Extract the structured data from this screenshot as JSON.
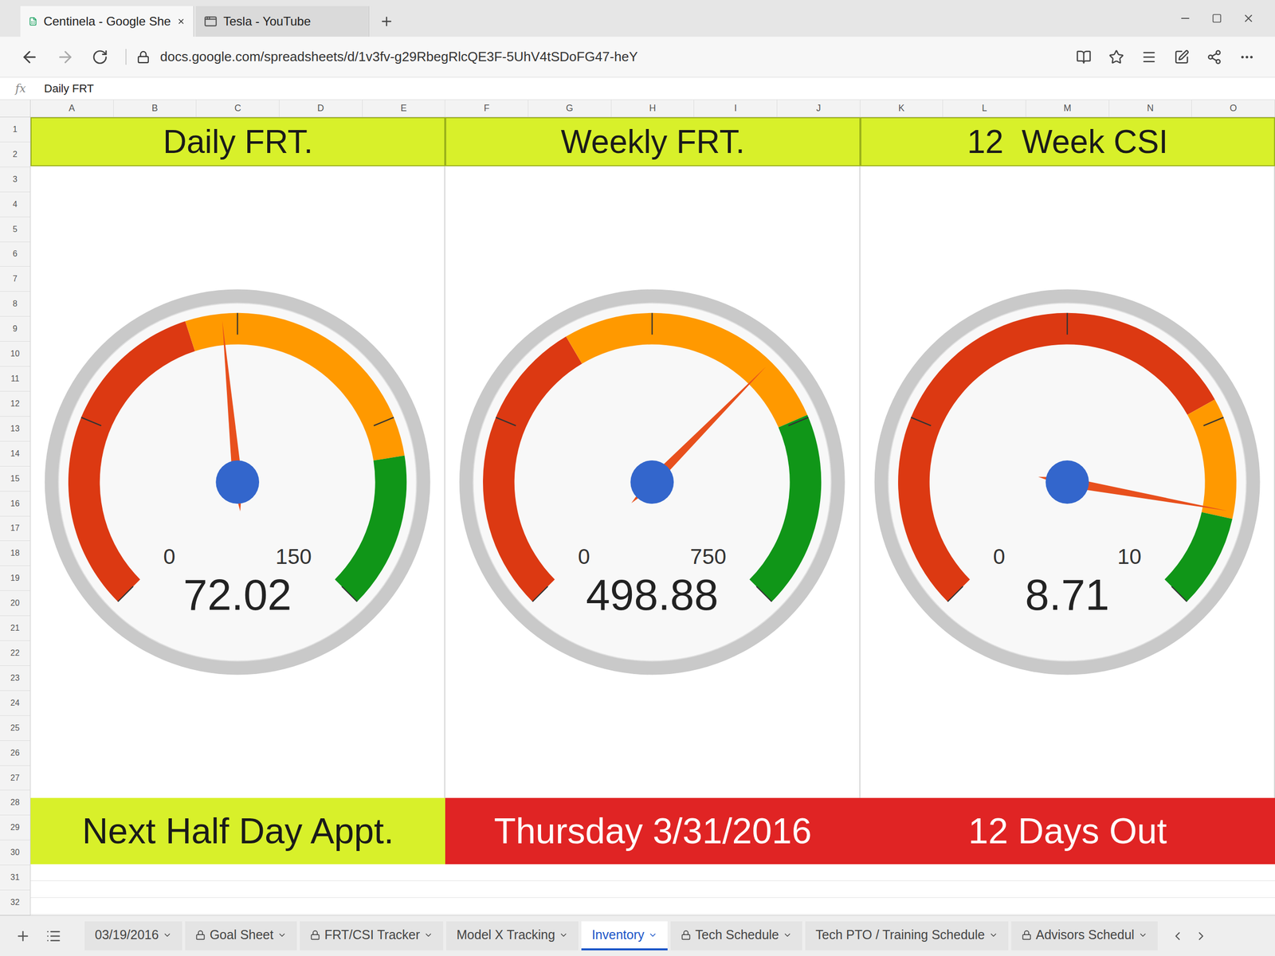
{
  "window": {
    "tabs": [
      {
        "label": "Centinela - Google She",
        "selected": true
      },
      {
        "label": "Tesla - YouTube",
        "selected": false
      }
    ],
    "address": "docs.google.com/spreadsheets/d/1v3fv-g29RbegRlcQE3F-5UhV4tSDoFG47-heY"
  },
  "formula_bar": {
    "fx": "fx",
    "content": "Daily FRT"
  },
  "columns": [
    "A",
    "B",
    "C",
    "D",
    "E",
    "F",
    "G",
    "H",
    "I",
    "J",
    "K",
    "L",
    "M",
    "N",
    "O"
  ],
  "rows": [
    "1",
    "2",
    "3",
    "4",
    "5",
    "6",
    "7",
    "8",
    "9",
    "10",
    "11",
    "12",
    "13",
    "14",
    "15",
    "16",
    "17",
    "18",
    "19",
    "20",
    "21",
    "22",
    "23",
    "24",
    "25",
    "26",
    "27",
    "28",
    "29",
    "30",
    "31",
    "32"
  ],
  "gauges": [
    {
      "title": "Daily FRT.",
      "value": "72.02",
      "min": "0",
      "max": "150",
      "level": 0.4801,
      "bands": [
        {
          "from": 0,
          "to": 65,
          "color": "#dc3912"
        },
        {
          "from": 65,
          "to": 120,
          "color": "#ff9900"
        },
        {
          "from": 120,
          "to": 150,
          "color": "#109618"
        }
      ]
    },
    {
      "title": "Weekly FRT.",
      "value": "498.88",
      "min": "0",
      "max": "750",
      "level": 0.6652,
      "bands": [
        {
          "from": 0,
          "to": 290,
          "color": "#dc3912"
        },
        {
          "from": 290,
          "to": 560,
          "color": "#ff9900"
        },
        {
          "from": 560,
          "to": 750,
          "color": "#109618"
        }
      ]
    },
    {
      "title": "12  Week CSI",
      "value": "8.71",
      "min": "0",
      "max": "10",
      "level": 0.871,
      "bands": [
        {
          "from": 0,
          "to": 7.25,
          "color": "#dc3912"
        },
        {
          "from": 7.25,
          "to": 8.8,
          "color": "#ff9900"
        },
        {
          "from": 8.8,
          "to": 10,
          "color": "#109618"
        }
      ]
    }
  ],
  "banners": [
    {
      "text": "Next Half Day Appt.",
      "color": "#d8f02a"
    },
    {
      "text": "Thursday 3/31/2016",
      "color": "#e02424"
    },
    {
      "text": "12 Days Out",
      "color": "#e02424"
    }
  ],
  "sheet_tabs": [
    {
      "label": "03/19/2016",
      "locked": false,
      "selected": false
    },
    {
      "label": "Goal Sheet",
      "locked": true,
      "selected": false
    },
    {
      "label": "FRT/CSI Tracker",
      "locked": true,
      "selected": false
    },
    {
      "label": "Model X Tracking",
      "locked": false,
      "selected": false
    },
    {
      "label": "Inventory",
      "locked": false,
      "selected": true
    },
    {
      "label": "Tech Schedule",
      "locked": true,
      "selected": false
    },
    {
      "label": "Tech PTO / Training Schedule",
      "locked": false,
      "selected": false
    },
    {
      "label": "Advisors Schedul",
      "locked": true,
      "selected": false
    }
  ]
}
